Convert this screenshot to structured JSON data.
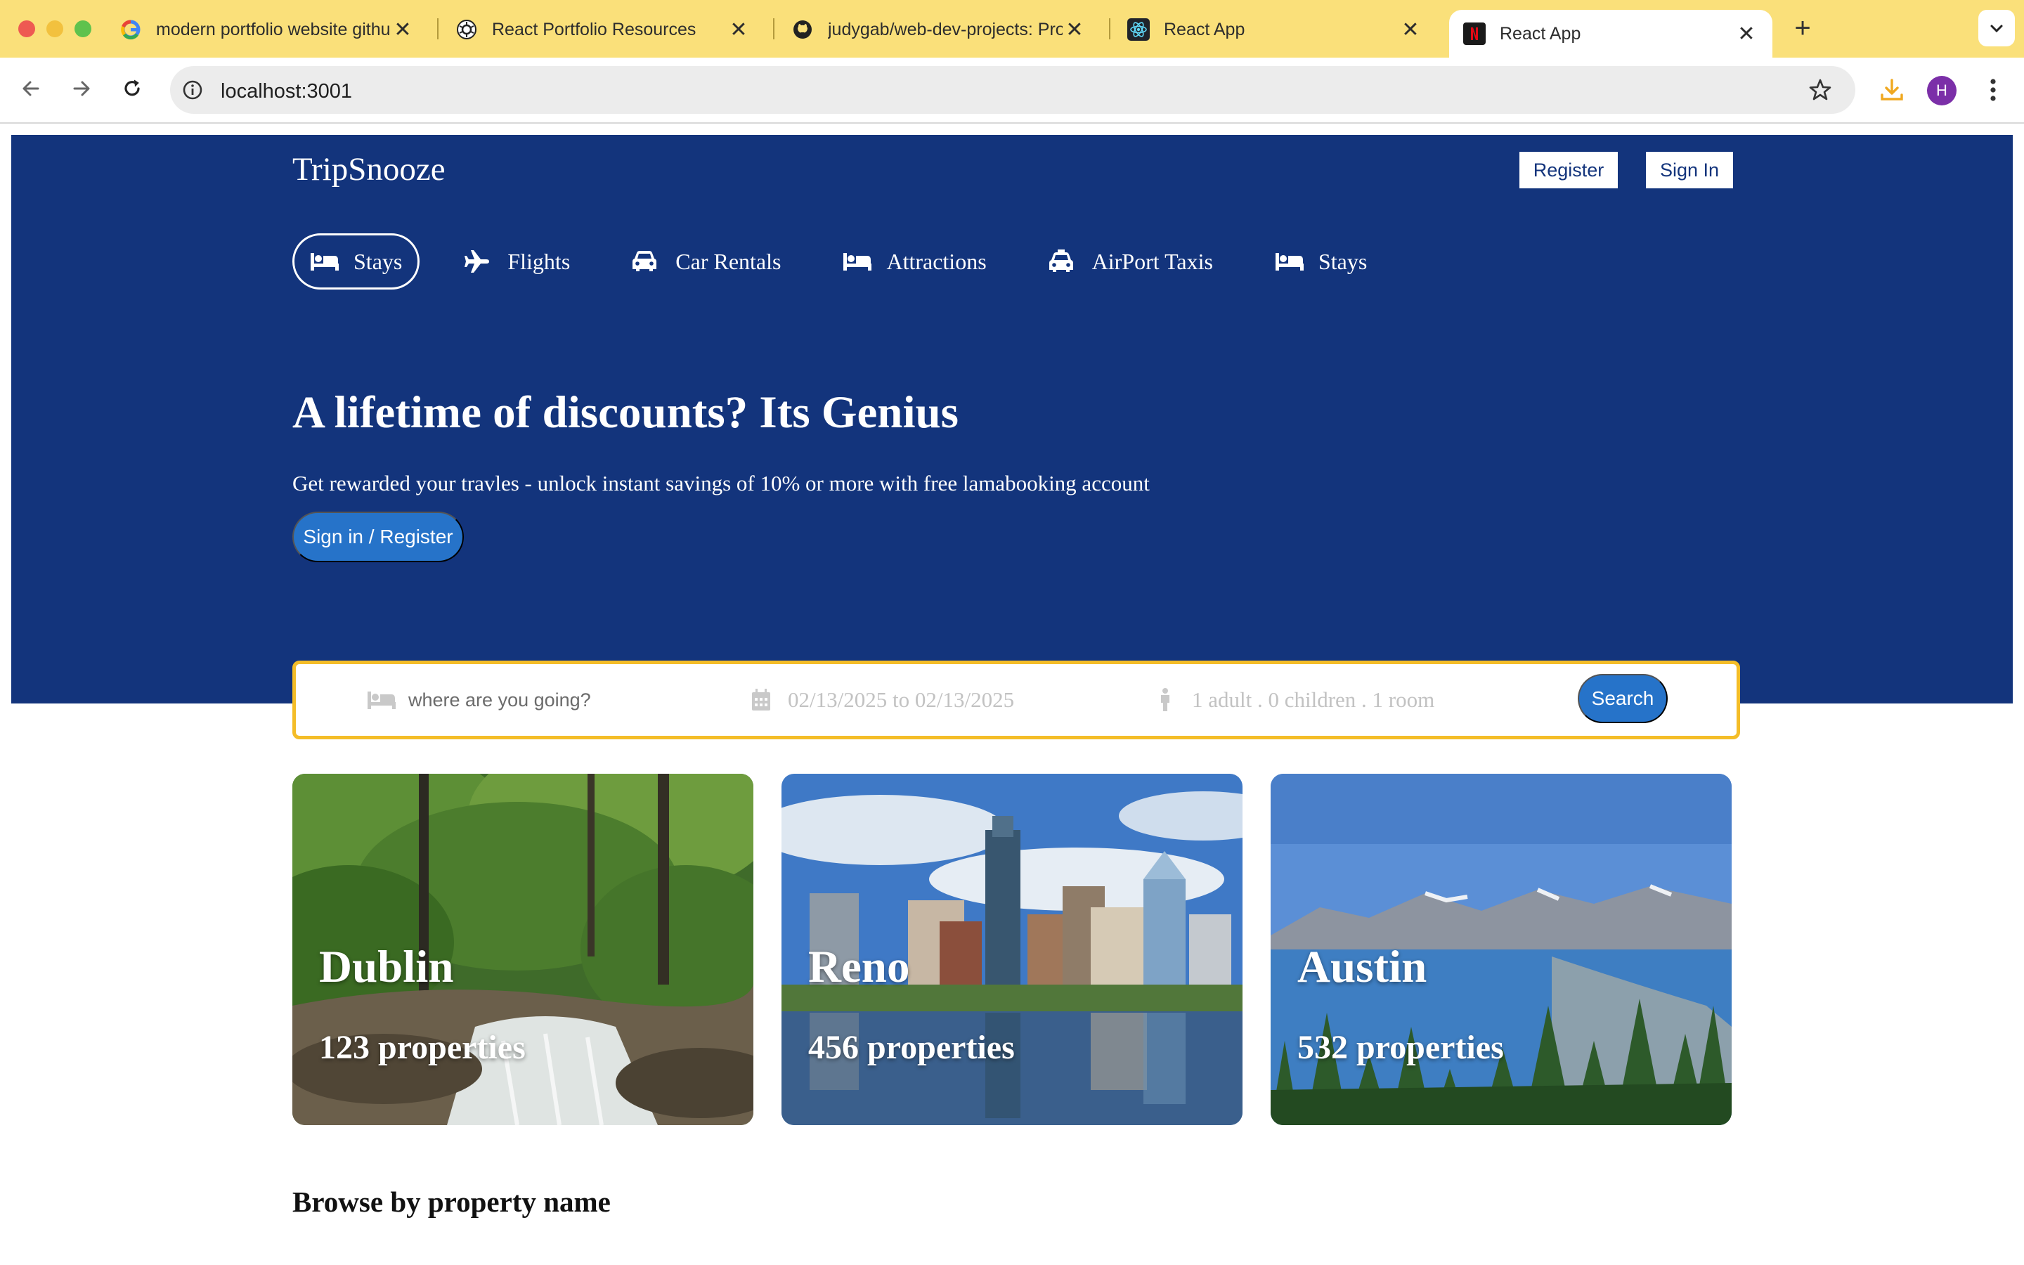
{
  "browser": {
    "tabs": [
      {
        "title": "modern portfolio website github",
        "favicon": "google-icon"
      },
      {
        "title": "React Portfolio Resources",
        "favicon": "openai-icon"
      },
      {
        "title": "judygab/web-dev-projects: Projects",
        "favicon": "github-icon"
      },
      {
        "title": "React App",
        "favicon": "react-icon"
      },
      {
        "title": "React App",
        "favicon": "app-icon",
        "active": true
      }
    ],
    "url": "localhost:3001",
    "profile_initial": "H",
    "accent_color": "#fae07a"
  },
  "header": {
    "brand": "TripSnooze",
    "register_label": "Register",
    "signin_label": "Sign In"
  },
  "nav": {
    "items": [
      {
        "label": "Stays",
        "icon": "bed-icon",
        "active": true
      },
      {
        "label": "Flights",
        "icon": "plane-icon"
      },
      {
        "label": "Car Rentals",
        "icon": "car-icon"
      },
      {
        "label": "Attractions",
        "icon": "bed-icon"
      },
      {
        "label": "AirPort Taxis",
        "icon": "taxi-icon"
      },
      {
        "label": "Stays",
        "icon": "bed-icon"
      }
    ]
  },
  "hero": {
    "title": "A lifetime of discounts? Its Genius",
    "subtitle": "Get rewarded your travles - unlock instant savings of 10% or more with free lamabooking account",
    "button_label": "Sign in / Register",
    "background_color": "#13347c"
  },
  "search": {
    "destination_placeholder": "where are you going?",
    "dates": "02/13/2025 to 02/13/2025",
    "guests": "1 adult . 0 children . 1 room",
    "button_label": "Search",
    "border_color": "#f4bd28"
  },
  "featured": [
    {
      "city": "Dublin",
      "properties": "123 properties"
    },
    {
      "city": "Reno",
      "properties": "456 properties"
    },
    {
      "city": "Austin",
      "properties": "532 properties"
    }
  ],
  "sections": {
    "browse_title": "Browse by property name"
  }
}
